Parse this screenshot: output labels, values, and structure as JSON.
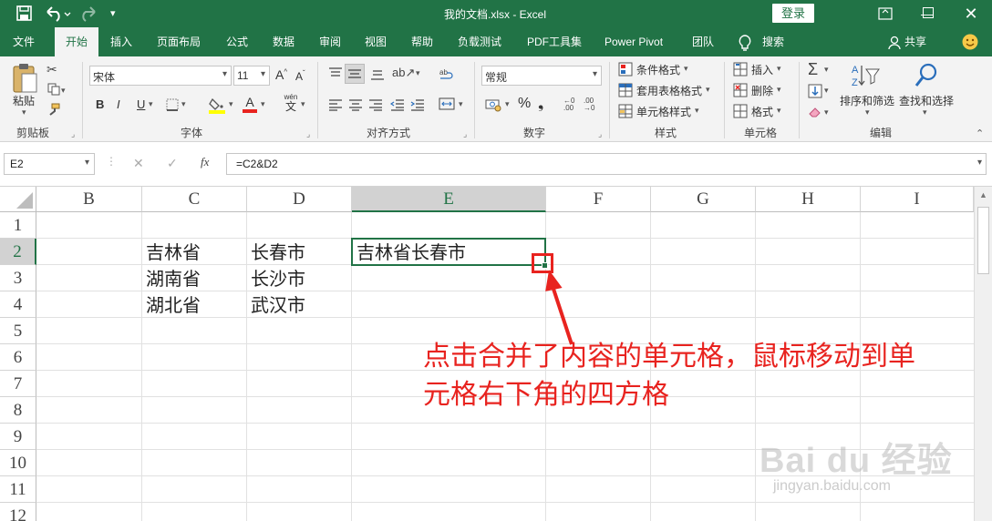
{
  "title_bar": {
    "save_icon": "save-icon",
    "undo_icon": "undo-icon",
    "redo_icon": "redo-icon",
    "title": "我的文档.xlsx  -  Excel",
    "login_label": "登录",
    "window_controls": [
      "ribbon-display-icon",
      "minimize-icon",
      "maximize-icon",
      "close-icon"
    ]
  },
  "tabs": [
    {
      "label": "文件"
    },
    {
      "label": "开始"
    },
    {
      "label": "插入"
    },
    {
      "label": "页面布局"
    },
    {
      "label": "公式"
    },
    {
      "label": "数据"
    },
    {
      "label": "审阅"
    },
    {
      "label": "视图"
    },
    {
      "label": "帮助"
    },
    {
      "label": "负载测试"
    },
    {
      "label": "PDF工具集"
    },
    {
      "label": "Power Pivot"
    },
    {
      "label": "团队"
    }
  ],
  "active_tab": "开始",
  "search_label": "搜索",
  "share_label": "共享",
  "ribbon": {
    "clipboard": {
      "paste_label": "粘贴",
      "group_label": "剪贴板"
    },
    "font": {
      "font_name": "宋体",
      "font_size": "11",
      "bold": "B",
      "italic": "I",
      "underline": "U",
      "wen_label": "wén",
      "wen_char": "文",
      "group_label": "字体"
    },
    "alignment": {
      "group_label": "对齐方式"
    },
    "number": {
      "format": "常规",
      "percent": "%",
      "group_label": "数字"
    },
    "styles": {
      "conditional": "条件格式",
      "table": "套用表格格式",
      "cell_styles": "单元格样式",
      "group_label": "样式"
    },
    "cells": {
      "insert": "插入",
      "delete": "删除",
      "format": "格式",
      "group_label": "单元格"
    },
    "editing": {
      "sort_filter": "排序和筛选",
      "find_select": "查找和选择",
      "group_label": "编辑"
    }
  },
  "formula_bar": {
    "name_box": "E2",
    "cancel": "✕",
    "enter": "✓",
    "fx": "fx",
    "formula": "=C2&D2"
  },
  "sheet": {
    "columns": [
      "B",
      "C",
      "D",
      "E",
      "F",
      "G",
      "H",
      "I"
    ],
    "rows": [
      "1",
      "2",
      "3",
      "4",
      "5",
      "6",
      "7",
      "8",
      "9",
      "10",
      "11",
      "12"
    ],
    "selected_cell": "E2",
    "cells": {
      "C2": "吉林省",
      "D2": "长春市",
      "E2": "吉林省长春市",
      "C3": "湖南省",
      "D3": "长沙市",
      "C4": "湖北省",
      "D4": "武汉市"
    }
  },
  "annotation": {
    "line1": "点击合并了内容的单元格，鼠标移动到单",
    "line2": "元格右下角的四方格",
    "color": "#e8231f"
  },
  "watermark": {
    "brand": "Bai du 经验",
    "url": "jingyan.baidu.com"
  },
  "colors": {
    "excel_green": "#217346",
    "ribbon_bg": "#f3f3f3",
    "annotation_red": "#e8231f"
  }
}
